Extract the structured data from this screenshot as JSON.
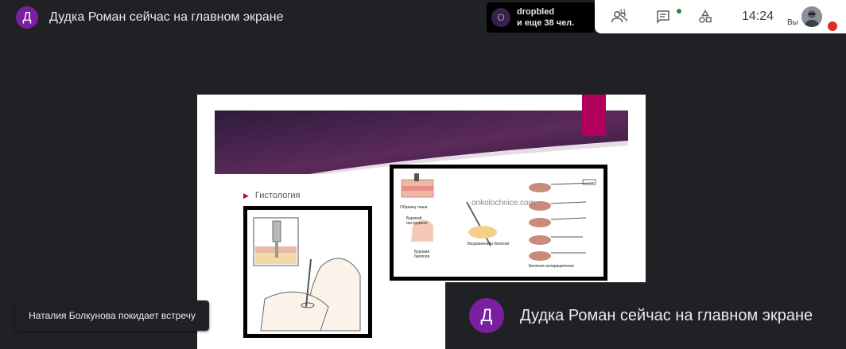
{
  "header": {
    "avatar_letter": "Д",
    "presenter_text": "Дудка Роман сейчас на главном экране"
  },
  "participants_chip": {
    "avatar_letter": "O",
    "name": "dropbled",
    "more_text": "и еще 38 чел."
  },
  "toolbar": {
    "people_count": "41",
    "clock": "14:24",
    "self_label": "Вы",
    "icons": [
      "people-icon",
      "chat-icon",
      "activities-icon",
      "mic-muted-icon"
    ]
  },
  "slide": {
    "bullet": "Гистология",
    "watermark": "onkolochnice.com",
    "right_figure_labels": {
      "tissue": "Образец ткани",
      "instrument": "Буровой инструмент",
      "drill_biopsy": "Буровая биопсия",
      "excision": "Эксцизионная биопсия",
      "aspiration": "Биопсия аспирационная"
    }
  },
  "toast": {
    "text": "Наталия Болкунова покидает встречу"
  },
  "pip": {
    "avatar_letter": "Д",
    "presenter_text": "Дудка Роман сейчас на главном экране"
  },
  "colors": {
    "background": "#202124",
    "avatar_purple": "#7b1fa2",
    "accent_pink": "#b0005c",
    "banner_purple": "#3a1d48"
  }
}
